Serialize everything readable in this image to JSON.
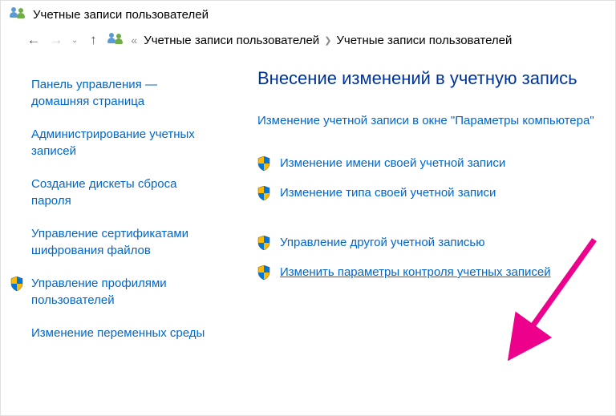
{
  "window_title": "Учетные записи пользователей",
  "breadcrumb": {
    "item1": "Учетные записи пользователей",
    "item2": "Учетные записи пользователей"
  },
  "sidebar": {
    "items": [
      {
        "label": "Панель управления — домашняя страница",
        "shield": false
      },
      {
        "label": "Администрирование учетных записей",
        "shield": false
      },
      {
        "label": "Создание дискеты сброса пароля",
        "shield": false
      },
      {
        "label": "Управление сертификатами шифрования файлов",
        "shield": false
      },
      {
        "label": "Управление профилями пользователей",
        "shield": true
      },
      {
        "label": "Изменение переменных среды",
        "shield": false
      }
    ]
  },
  "main": {
    "heading": "Внесение изменений в учетную запись",
    "actions": [
      {
        "label": "Изменение учетной записи в окне \"Параметры компьютера\"",
        "shield": false
      },
      {
        "label": "Изменение имени своей учетной записи",
        "shield": true
      },
      {
        "label": "Изменение типа своей учетной записи",
        "shield": true
      },
      {
        "label": "Управление другой учетной записью",
        "shield": true
      },
      {
        "label": "Изменить параметры контроля учетных записей",
        "shield": true,
        "highlight": true
      }
    ]
  }
}
